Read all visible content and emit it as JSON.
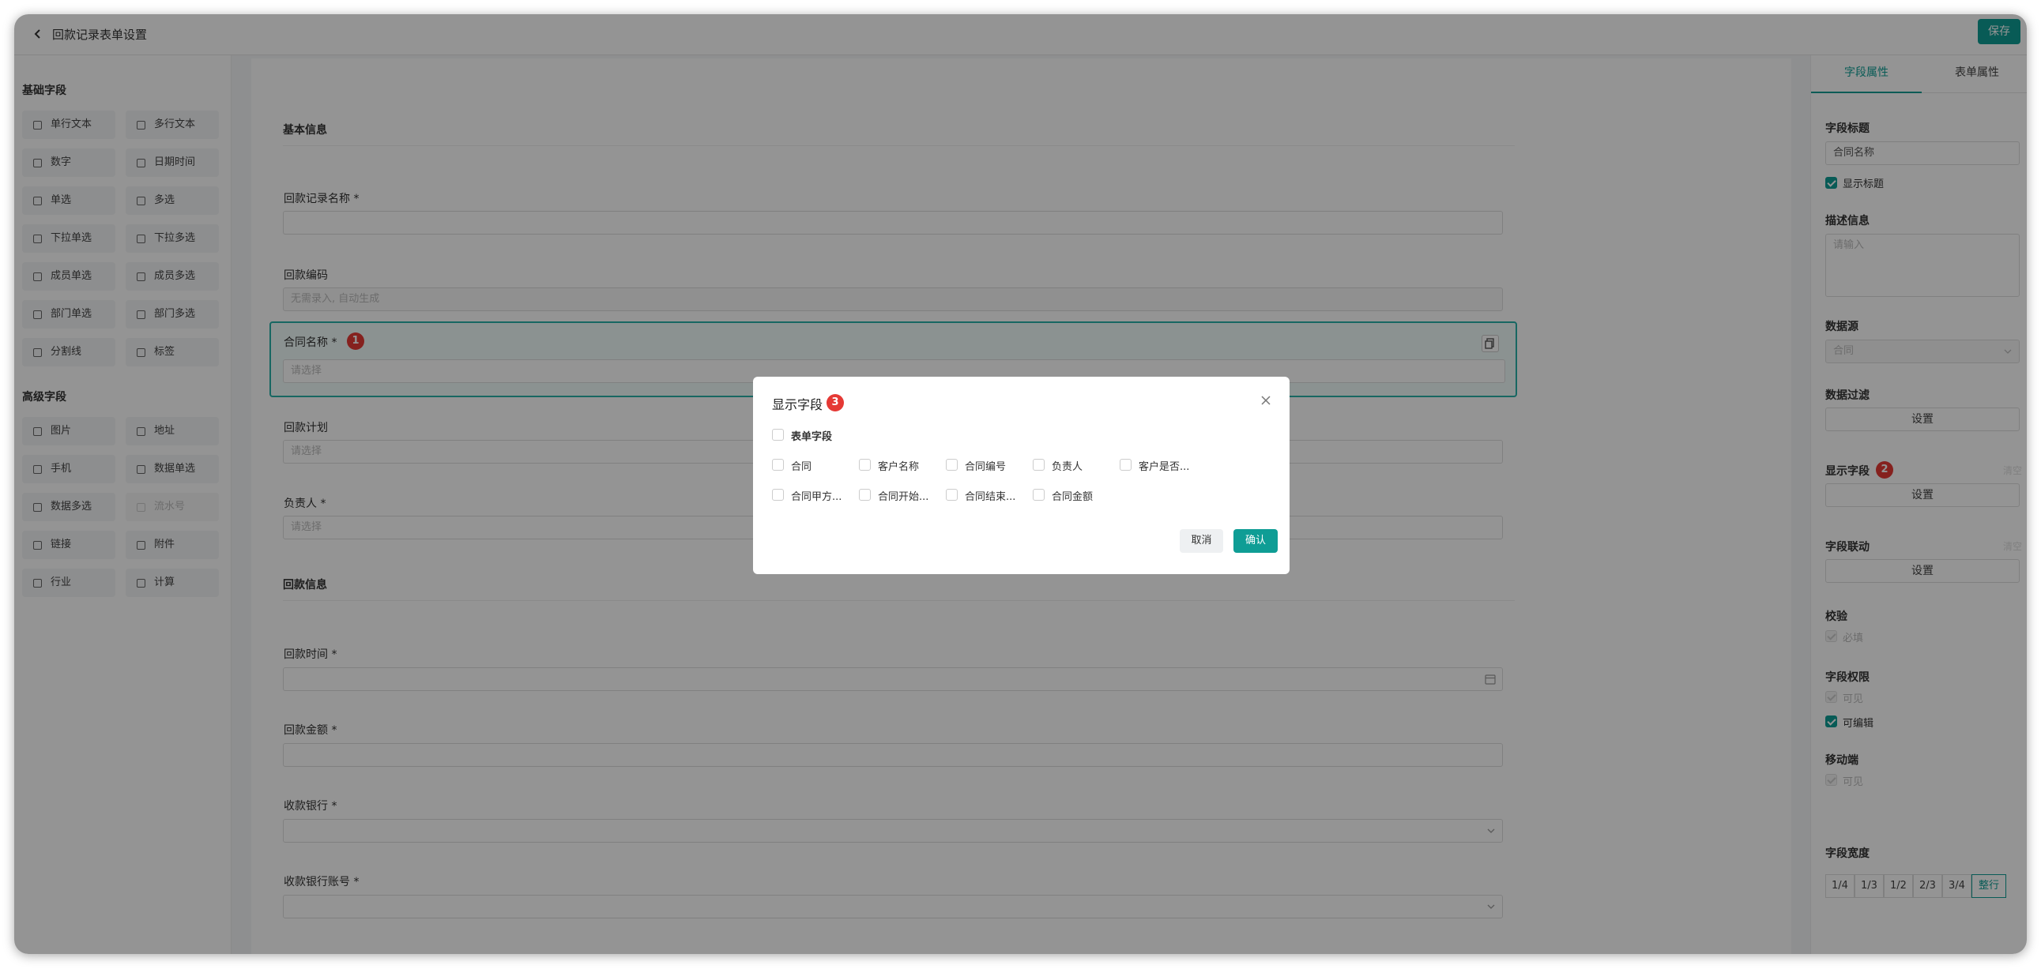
{
  "header": {
    "title": "回款记录表单设置",
    "save_label": "保存"
  },
  "left": {
    "basic_title": "基础字段",
    "basic": [
      {
        "label": "单行文本",
        "icon": "text-line-icon"
      },
      {
        "label": "多行文本",
        "icon": "text-multi-icon"
      },
      {
        "label": "数字",
        "icon": "number-icon"
      },
      {
        "label": "日期时间",
        "icon": "calendar-icon"
      },
      {
        "label": "单选",
        "icon": "radio-icon"
      },
      {
        "label": "多选",
        "icon": "checkbox-icon"
      },
      {
        "label": "下拉单选",
        "icon": "list-icon"
      },
      {
        "label": "下拉多选",
        "icon": "list-multi-icon"
      },
      {
        "label": "成员单选",
        "icon": "user-icon"
      },
      {
        "label": "成员多选",
        "icon": "users-icon"
      },
      {
        "label": "部门单选",
        "icon": "dept-icon"
      },
      {
        "label": "部门多选",
        "icon": "dept-multi-icon"
      },
      {
        "label": "分割线",
        "icon": "divider-icon"
      },
      {
        "label": "标签",
        "icon": "tag-icon"
      }
    ],
    "advanced_title": "高级字段",
    "advanced": [
      {
        "label": "图片",
        "icon": "image-icon"
      },
      {
        "label": "地址",
        "icon": "map-icon"
      },
      {
        "label": "手机",
        "icon": "phone-icon"
      },
      {
        "label": "数据单选",
        "icon": "data-single-icon"
      },
      {
        "label": "数据多选",
        "icon": "data-multi-icon"
      },
      {
        "label": "流水号",
        "icon": "serial-icon"
      },
      {
        "label": "链接",
        "icon": "link-icon"
      },
      {
        "label": "附件",
        "icon": "attachment-icon"
      },
      {
        "label": "行业",
        "icon": "industry-icon"
      },
      {
        "label": "计算",
        "icon": "calculate-icon"
      }
    ]
  },
  "form": {
    "section1": "基本信息",
    "section2": "回款信息",
    "fields": {
      "record_name": {
        "label": "回款记录名称 *",
        "value": ""
      },
      "code": {
        "label": "回款编码",
        "placeholder": "无需录入, 自动生成"
      },
      "contract": {
        "label": "合同名称 *",
        "placeholder": "请选择"
      },
      "plan": {
        "label": "回款计划",
        "placeholder": "请选择"
      },
      "owner": {
        "label": "负责人 *",
        "placeholder": "请选择"
      },
      "time": {
        "label": "回款时间 *",
        "value": ""
      },
      "amount": {
        "label": "回款金额 *",
        "value": ""
      },
      "bank": {
        "label": "收款银行 *",
        "value": ""
      },
      "account": {
        "label": "收款银行账号 *",
        "value": ""
      }
    }
  },
  "badges": {
    "b1": "1",
    "b2": "2",
    "b3": "3"
  },
  "right": {
    "tabs": [
      "字段属性",
      "表单属性"
    ],
    "field_title_label": "字段标题",
    "field_title_value": "合同名称",
    "show_title": "显示标题",
    "desc_label": "描述信息",
    "desc_placeholder": "请输入",
    "source_label": "数据源",
    "source_value": "合同",
    "filter_label": "数据过滤",
    "set": "设置",
    "display_label": "显示字段",
    "link_label": "字段联动",
    "clear": "清空",
    "validate_label": "校验",
    "required": "必填",
    "perm_label": "字段权限",
    "visible": "可见",
    "editable": "可编辑",
    "mobile_label": "移动端",
    "mobile_visible": "可见",
    "width_label": "字段宽度",
    "widths": [
      "1/4",
      "1/3",
      "1/2",
      "2/3",
      "3/4",
      "整行"
    ],
    "width_selected": "整行"
  },
  "dialog": {
    "title": "显示字段",
    "form_fields": "表单字段",
    "options": [
      "合同",
      "客户名称",
      "合同编号",
      "负责人",
      "客户是否...",
      "合同甲方...",
      "合同开始...",
      "合同结束...",
      "合同金额"
    ],
    "cancel": "取消",
    "confirm": "确认"
  },
  "colors": {
    "accent": "#0f9d95",
    "badge": "#e53935"
  }
}
